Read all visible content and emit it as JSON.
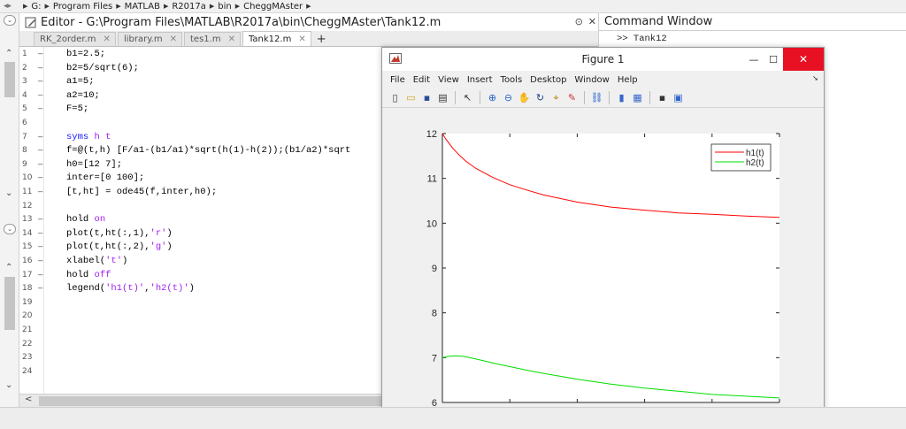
{
  "path_bar": {
    "segments": [
      "G:",
      "Program Files",
      "MATLAB",
      "R2017a",
      "bin",
      "CheggMAster"
    ]
  },
  "editor": {
    "title": "Editor - G:\\Program Files\\MATLAB\\R2017a\\bin\\CheggMAster\\Tank12.m",
    "tabs": [
      {
        "label": "RK_2order.m",
        "active": false
      },
      {
        "label": "library.m",
        "active": false
      },
      {
        "label": "tes1.m",
        "active": false
      },
      {
        "label": "Tank12.m",
        "active": true
      }
    ],
    "lines": [
      {
        "num": "1",
        "dash": true,
        "text": "b1=2.5;"
      },
      {
        "num": "2",
        "dash": true,
        "text": "b2=5/sqrt(6);"
      },
      {
        "num": "3",
        "dash": true,
        "text": "a1=5;"
      },
      {
        "num": "4",
        "dash": true,
        "text": "a2=10;"
      },
      {
        "num": "5",
        "dash": true,
        "text": "F=5;"
      },
      {
        "num": "6",
        "dash": false,
        "text": ""
      },
      {
        "num": "7",
        "dash": true,
        "text": "syms h t"
      },
      {
        "num": "8",
        "dash": true,
        "text": "f=@(t,h) [F/a1-(b1/a1)*sqrt(h(1)-h(2));(b1/a2)*sqrt"
      },
      {
        "num": "9",
        "dash": true,
        "text": "h0=[12 7];"
      },
      {
        "num": "10",
        "dash": true,
        "text": "inter=[0 100];"
      },
      {
        "num": "11",
        "dash": true,
        "text": "[t,ht] = ode45(f,inter,h0);"
      },
      {
        "num": "12",
        "dash": false,
        "text": ""
      },
      {
        "num": "13",
        "dash": true,
        "text": "hold on"
      },
      {
        "num": "14",
        "dash": true,
        "text": "plot(t,ht(:,1),'r')"
      },
      {
        "num": "15",
        "dash": true,
        "text": "plot(t,ht(:,2),'g')"
      },
      {
        "num": "16",
        "dash": true,
        "text": "xlabel('t')"
      },
      {
        "num": "17",
        "dash": true,
        "text": "hold off"
      },
      {
        "num": "18",
        "dash": true,
        "text": "legend('h1(t)','h2(t)')"
      },
      {
        "num": "19",
        "dash": false,
        "text": ""
      },
      {
        "num": "20",
        "dash": false,
        "text": ""
      },
      {
        "num": "21",
        "dash": false,
        "text": ""
      },
      {
        "num": "22",
        "dash": false,
        "text": ""
      },
      {
        "num": "23",
        "dash": false,
        "text": ""
      },
      {
        "num": "24",
        "dash": false,
        "text": ""
      }
    ],
    "line8_tail": ""
  },
  "command_window": {
    "title": "Command Window",
    "line": ">> Tank12"
  },
  "figure": {
    "title": "Figure 1",
    "menu": [
      "File",
      "Edit",
      "View",
      "Insert",
      "Tools",
      "Desktop",
      "Window",
      "Help"
    ],
    "toolbar_icons": [
      "new-figure-icon",
      "open-icon",
      "save-icon",
      "print-icon",
      "pointer-icon",
      "zoom-in-icon",
      "zoom-out-icon",
      "pan-icon",
      "rotate-icon",
      "data-cursor-icon",
      "brush-icon",
      "link-icon",
      "colorbar-icon",
      "legend-icon",
      "hide-plot-tools-icon",
      "show-plot-tools-icon"
    ]
  },
  "colors": {
    "h1": "#ff0000",
    "h2": "#00dd00",
    "close_button": "#e81123"
  },
  "chart_data": {
    "type": "line",
    "title": "",
    "xlabel": "",
    "ylabel": "",
    "xlim": [
      0,
      100
    ],
    "ylim": [
      6,
      12
    ],
    "xticks": [
      0,
      20,
      40,
      60,
      80,
      100
    ],
    "yticks": [
      6,
      7,
      8,
      9,
      10,
      11,
      12
    ],
    "legend": {
      "position": "top-right",
      "entries": [
        "h1(t)",
        "h2(t)"
      ]
    },
    "series": [
      {
        "name": "h1(t)",
        "color": "#ff0000",
        "x": [
          0,
          1,
          2,
          3,
          5,
          7,
          10,
          15,
          20,
          25,
          30,
          40,
          50,
          60,
          70,
          80,
          90,
          100
        ],
        "y": [
          12.0,
          11.88,
          11.78,
          11.68,
          11.52,
          11.38,
          11.22,
          11.02,
          10.86,
          10.74,
          10.63,
          10.47,
          10.36,
          10.29,
          10.23,
          10.2,
          10.16,
          10.13
        ]
      },
      {
        "name": "h2(t)",
        "color": "#00dd00",
        "x": [
          0,
          2,
          4,
          6,
          8,
          10,
          15,
          20,
          25,
          30,
          40,
          50,
          60,
          70,
          80,
          90,
          100
        ],
        "y": [
          7.0,
          7.03,
          7.04,
          7.03,
          7.0,
          6.97,
          6.88,
          6.8,
          6.72,
          6.65,
          6.52,
          6.41,
          6.32,
          6.25,
          6.18,
          6.14,
          6.1
        ]
      }
    ]
  }
}
